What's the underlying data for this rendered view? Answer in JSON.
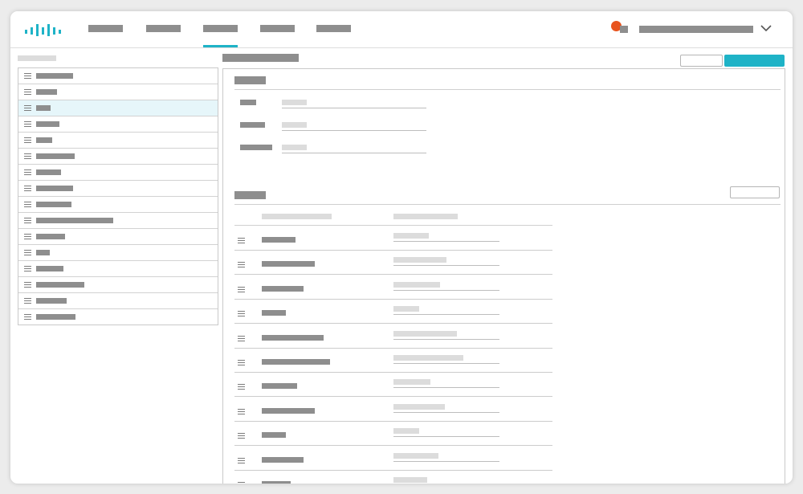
{
  "brand": {
    "logo_icon": "cisco-bars-logo-icon",
    "accent": "#1fb3c7",
    "notification_color": "#e8541e"
  },
  "topnav": {
    "items": [
      {
        "id": "nav-1",
        "active": false
      },
      {
        "id": "nav-2",
        "active": false
      },
      {
        "id": "nav-3",
        "active": true
      },
      {
        "id": "nav-4",
        "active": false
      },
      {
        "id": "nav-5",
        "active": false
      }
    ]
  },
  "user": {
    "notification_icon": "notification-dot-icon",
    "menu_icon": "chevron-down-icon"
  },
  "sidebar": {
    "item_count": 16,
    "selected_index": 2,
    "item_icon": "menu-icon"
  },
  "main": {
    "actions": [
      "secondary-button",
      "primary-button"
    ],
    "section1": {
      "field_count": 3
    },
    "section2": {
      "row_count": 11,
      "row_icon": "drag-handle-icon"
    }
  }
}
